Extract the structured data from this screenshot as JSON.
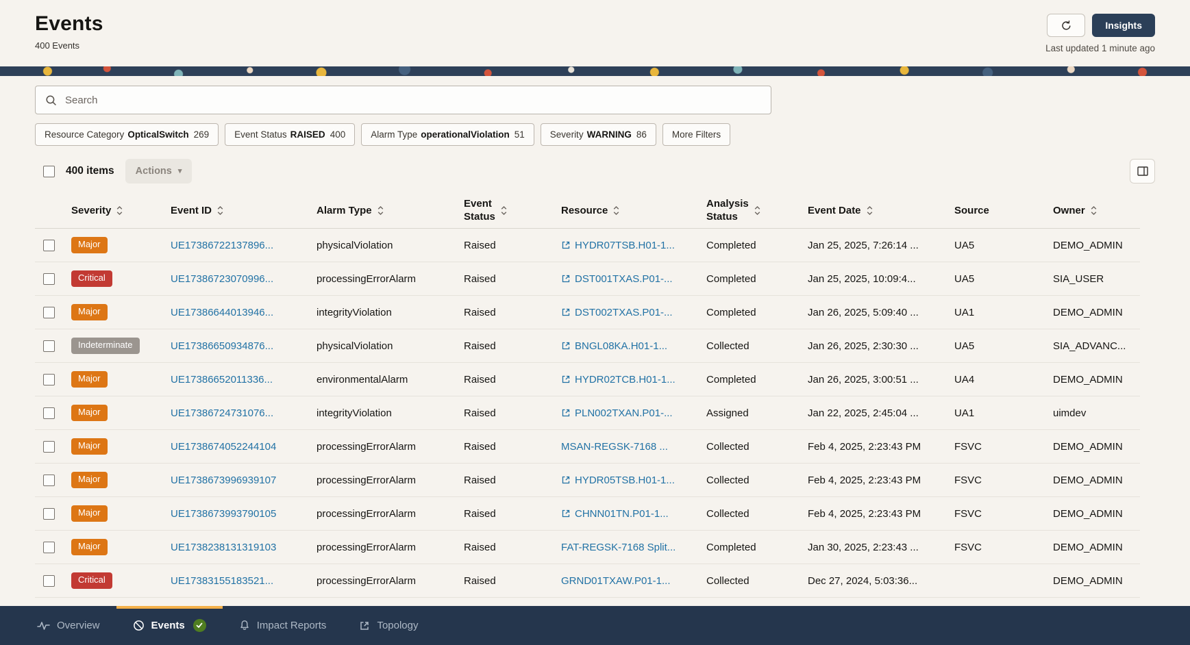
{
  "colors": {
    "navbar_navy": "#25364d",
    "insights_button_navy": "#2b3f58",
    "severity_critical": "#c23a33",
    "severity_major": "#dd7615",
    "severity_indeterminate": "#9b958f",
    "link_blue": "#2272a5",
    "active_tab_indicator": "#f3b04a",
    "check_badge_green": "#4f7d21",
    "page_background": "#f6f3ee"
  },
  "header": {
    "title": "Events",
    "subtitle": "400 Events",
    "insights_label": "Insights",
    "last_updated": "Last updated 1 minute ago"
  },
  "search": {
    "placeholder": "Search"
  },
  "filters": {
    "chips": [
      {
        "label": "Resource Category",
        "value": "OpticalSwitch",
        "count": "269"
      },
      {
        "label": "Event Status",
        "value": "RAISED",
        "count": "400"
      },
      {
        "label": "Alarm Type",
        "value": "operationalViolation",
        "count": "51"
      },
      {
        "label": "Severity",
        "value": "WARNING",
        "count": "86"
      },
      {
        "label": "More Filters",
        "value": "",
        "count": ""
      }
    ]
  },
  "toolbar": {
    "items_count": "400 items",
    "actions_label": "Actions"
  },
  "table": {
    "columns": [
      {
        "label": "Severity",
        "sortable": true,
        "wrap": false
      },
      {
        "label": "Event ID",
        "sortable": true,
        "wrap": false
      },
      {
        "label": "Alarm Type",
        "sortable": true,
        "wrap": false
      },
      {
        "label": "Event Status",
        "sortable": true,
        "wrap": true
      },
      {
        "label": "Resource",
        "sortable": true,
        "wrap": false
      },
      {
        "label": "Analysis Status",
        "sortable": true,
        "wrap": true
      },
      {
        "label": "Event Date",
        "sortable": true,
        "wrap": false
      },
      {
        "label": "Source",
        "sortable": false,
        "wrap": false
      },
      {
        "label": "Owner",
        "sortable": true,
        "wrap": false
      }
    ],
    "rows": [
      {
        "severity": "Major",
        "event_id": "UE17386722137896...",
        "alarm_type": "physicalViolation",
        "event_status": "Raised",
        "resource": "HYDR07TSB.H01-1...",
        "resource_external": true,
        "analysis_status": "Completed",
        "event_date": "Jan 25, 2025, 7:26:14 ...",
        "source": "UA5",
        "owner": "DEMO_ADMIN"
      },
      {
        "severity": "Critical",
        "event_id": "UE17386723070996...",
        "alarm_type": "processingErrorAlarm",
        "event_status": "Raised",
        "resource": "DST001TXAS.P01-...",
        "resource_external": true,
        "analysis_status": "Completed",
        "event_date": "Jan 25, 2025, 10:09:4...",
        "source": "UA5",
        "owner": "SIA_USER"
      },
      {
        "severity": "Major",
        "event_id": "UE17386644013946...",
        "alarm_type": "integrityViolation",
        "event_status": "Raised",
        "resource": "DST002TXAS.P01-...",
        "resource_external": true,
        "analysis_status": "Completed",
        "event_date": "Jan 26, 2025, 5:09:40 ...",
        "source": "UA1",
        "owner": "DEMO_ADMIN"
      },
      {
        "severity": "Indeterminate",
        "event_id": "UE17386650934876...",
        "alarm_type": "physicalViolation",
        "event_status": "Raised",
        "resource": "BNGL08KA.H01-1...",
        "resource_external": true,
        "analysis_status": "Collected",
        "event_date": "Jan 26, 2025, 2:30:30 ...",
        "source": "UA5",
        "owner": "SIA_ADVANC..."
      },
      {
        "severity": "Major",
        "event_id": "UE17386652011336...",
        "alarm_type": "environmentalAlarm",
        "event_status": "Raised",
        "resource": "HYDR02TCB.H01-1...",
        "resource_external": true,
        "analysis_status": "Completed",
        "event_date": "Jan 26, 2025, 3:00:51 ...",
        "source": "UA4",
        "owner": "DEMO_ADMIN"
      },
      {
        "severity": "Major",
        "event_id": "UE17386724731076...",
        "alarm_type": "integrityViolation",
        "event_status": "Raised",
        "resource": "PLN002TXAN.P01-...",
        "resource_external": true,
        "analysis_status": "Assigned",
        "event_date": "Jan 22, 2025, 2:45:04 ...",
        "source": "UA1",
        "owner": "uimdev"
      },
      {
        "severity": "Major",
        "event_id": "UE1738674052244104",
        "alarm_type": "processingErrorAlarm",
        "event_status": "Raised",
        "resource": "MSAN-REGSK-7168 ...",
        "resource_external": false,
        "analysis_status": "Collected",
        "event_date": "Feb 4, 2025, 2:23:43 PM",
        "source": "FSVC",
        "owner": "DEMO_ADMIN"
      },
      {
        "severity": "Major",
        "event_id": "UE1738673996939107",
        "alarm_type": "processingErrorAlarm",
        "event_status": "Raised",
        "resource": "HYDR05TSB.H01-1...",
        "resource_external": true,
        "analysis_status": "Collected",
        "event_date": "Feb 4, 2025, 2:23:43 PM",
        "source": "FSVC",
        "owner": "DEMO_ADMIN"
      },
      {
        "severity": "Major",
        "event_id": "UE1738673993790105",
        "alarm_type": "processingErrorAlarm",
        "event_status": "Raised",
        "resource": "CHNN01TN.P01-1...",
        "resource_external": true,
        "analysis_status": "Collected",
        "event_date": "Feb 4, 2025, 2:23:43 PM",
        "source": "FSVC",
        "owner": "DEMO_ADMIN"
      },
      {
        "severity": "Major",
        "event_id": "UE1738238131319103",
        "alarm_type": "processingErrorAlarm",
        "event_status": "Raised",
        "resource": "FAT-REGSK-7168 Split...",
        "resource_external": false,
        "analysis_status": "Completed",
        "event_date": "Jan 30, 2025, 2:23:43 ...",
        "source": "FSVC",
        "owner": "DEMO_ADMIN"
      },
      {
        "severity": "Critical",
        "event_id": "UE17383155183521...",
        "alarm_type": "processingErrorAlarm",
        "event_status": "Raised",
        "resource": "GRND01TXAW.P01-1...",
        "resource_external": false,
        "analysis_status": "Collected",
        "event_date": "Dec 27, 2024, 5:03:36...",
        "source": "",
        "owner": "DEMO_ADMIN"
      }
    ]
  },
  "footer": {
    "tabs": [
      {
        "label": "Overview",
        "icon": "activity-icon",
        "active": false,
        "badge": ""
      },
      {
        "label": "Events",
        "icon": "events-icon",
        "active": true,
        "badge": "check"
      },
      {
        "label": "Impact Reports",
        "icon": "bell-icon",
        "active": false,
        "badge": ""
      },
      {
        "label": "Topology",
        "icon": "topology-icon",
        "active": false,
        "badge": ""
      }
    ]
  }
}
